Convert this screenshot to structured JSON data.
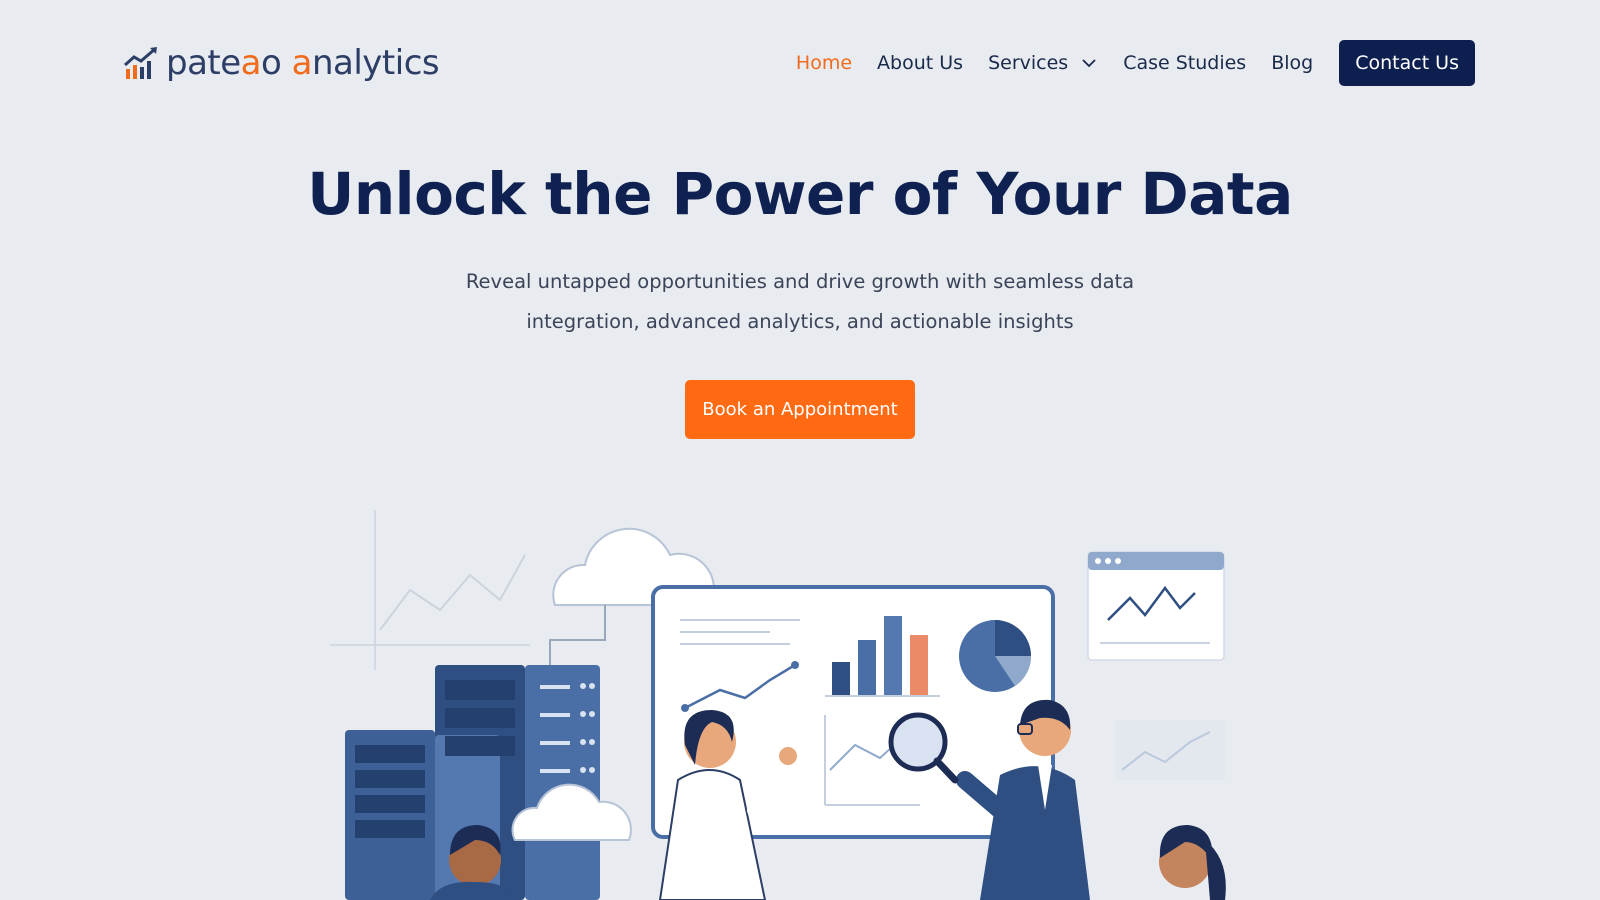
{
  "brand": {
    "name_part1": "pate",
    "name_o1": "a",
    "name_part2": "o ",
    "name_o2": "a",
    "name_part3": "nalytics",
    "accent": "#f26b1d",
    "navy": "#0d1f4f"
  },
  "nav": {
    "items": [
      {
        "label": "Home",
        "active": true
      },
      {
        "label": "About Us"
      },
      {
        "label": "Services",
        "has_dropdown": true
      },
      {
        "label": "Case Studies"
      },
      {
        "label": "Blog"
      }
    ],
    "contact_label": "Contact Us"
  },
  "hero": {
    "title": "Unlock the Power of Your Data",
    "subtitle_line1": "Reveal untapped opportunities and drive growth with seamless data",
    "subtitle_line2": "integration, advanced analytics, and actionable insights",
    "cta_label": "Book an Appointment",
    "cta_color": "#ff6a13"
  },
  "icons": {
    "logo": "bar-chart-trend-icon",
    "dropdown": "chevron-down-icon"
  }
}
